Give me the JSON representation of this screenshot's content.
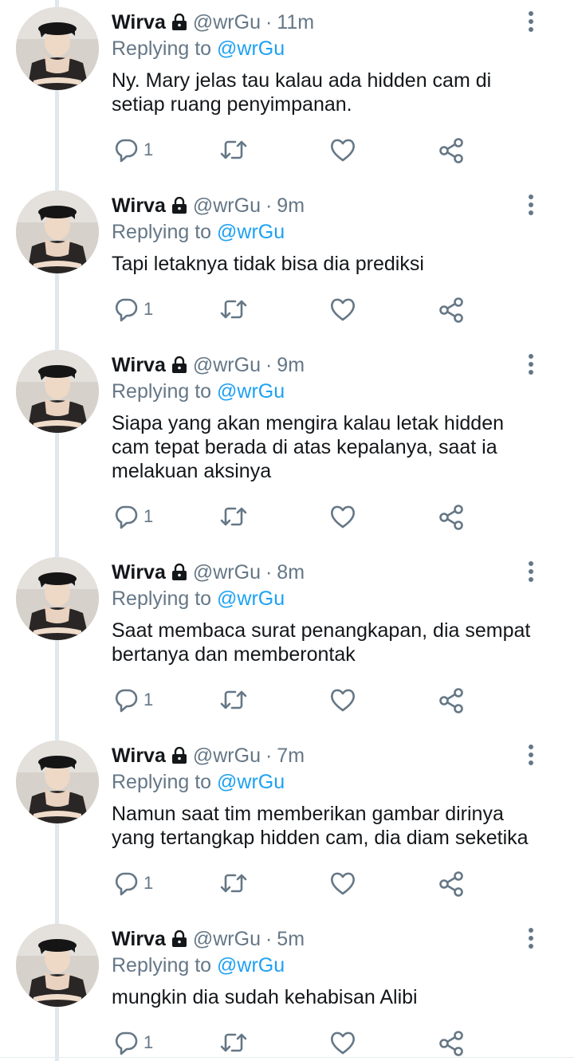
{
  "colors": {
    "text": "#14171a",
    "muted": "#657786",
    "accent": "#1da1f2",
    "thread": "#e1e8ed"
  },
  "icons": {
    "lock": "lock-icon",
    "more": "more-vertical-icon",
    "reply": "reply-icon",
    "retweet": "retweet-icon",
    "like": "like-icon",
    "share": "share-icon"
  },
  "tweets": [
    {
      "name": "Wirva",
      "handle": "@wrGu",
      "sep": "·",
      "time": "11m",
      "replying_label": "Replying to",
      "replying_to": "@wrGu",
      "lines": [
        "Ny. Mary jelas tau kalau ada hidden cam di",
        "setiap ruang penyimpanan."
      ],
      "reply_count": "1"
    },
    {
      "name": "Wirva",
      "handle": "@wrGu",
      "sep": "·",
      "time": "9m",
      "replying_label": "Replying to",
      "replying_to": "@wrGu",
      "lines": [
        "Tapi letaknya tidak bisa dia prediksi"
      ],
      "reply_count": "1"
    },
    {
      "name": "Wirva",
      "handle": "@wrGu",
      "sep": "·",
      "time": "9m",
      "replying_label": "Replying to",
      "replying_to": "@wrGu",
      "lines": [
        "Siapa yang akan mengira kalau letak hidden",
        "cam tepat berada di atas kepalanya, saat ia",
        "melakuan aksinya"
      ],
      "reply_count": "1"
    },
    {
      "name": "Wirva",
      "handle": "@wrGu",
      "sep": "·",
      "time": "8m",
      "replying_label": "Replying to",
      "replying_to": "@wrGu",
      "lines": [
        "Saat membaca surat penangkapan, dia sempat",
        "bertanya dan memberontak"
      ],
      "reply_count": "1"
    },
    {
      "name": "Wirva",
      "handle": "@wrGu",
      "sep": "·",
      "time": "7m",
      "replying_label": "Replying to",
      "replying_to": "@wrGu",
      "lines": [
        "Namun saat tim memberikan gambar dirinya",
        "yang tertangkap hidden cam, dia diam seketika"
      ],
      "reply_count": "1"
    },
    {
      "name": "Wirva",
      "handle": "@wrGu",
      "sep": "·",
      "time": "5m",
      "replying_label": "Replying to",
      "replying_to": "@wrGu",
      "lines": [
        "mungkin dia sudah kehabisan Alibi"
      ],
      "reply_count": "1"
    }
  ]
}
